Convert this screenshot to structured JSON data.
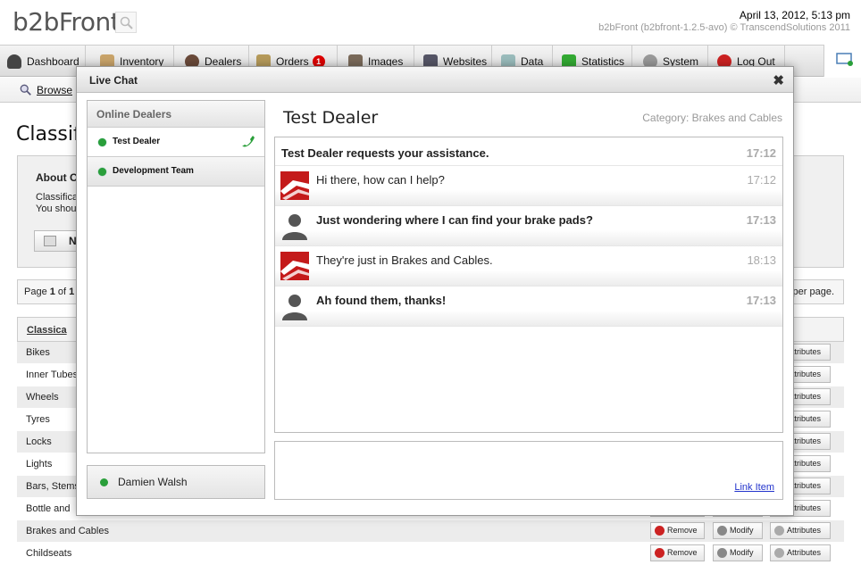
{
  "header": {
    "logo": "b2bFront",
    "datetime": "April 13, 2012, 5:13 pm",
    "version": "b2bFront (b2bfront-1.2.5-avo) © TranscendSolutions 2011"
  },
  "nav": {
    "items": [
      {
        "label": "Dashboard",
        "icon": "dashboard-icon"
      },
      {
        "label": "Inventory",
        "icon": "box-icon"
      },
      {
        "label": "Dealers",
        "icon": "person-icon"
      },
      {
        "label": "Orders",
        "icon": "orders-icon",
        "badge": "1"
      },
      {
        "label": "Images",
        "icon": "images-icon"
      },
      {
        "label": "Websites",
        "icon": "websites-icon"
      },
      {
        "label": "Data",
        "icon": "data-icon"
      },
      {
        "label": "Statistics",
        "icon": "chart-icon"
      },
      {
        "label": "System",
        "icon": "gear-icon"
      },
      {
        "label": "Log Out",
        "icon": "logout-icon"
      }
    ],
    "sub": {
      "browse": "Browse"
    }
  },
  "page": {
    "title": "Classific",
    "about_title": "About C",
    "about_text1": "Classifica",
    "about_text2": "You shou",
    "new_button": "N",
    "pager_left_prefix": "Page ",
    "pager_page": "1",
    "pager_of": " of ",
    "pager_total": "1",
    "pager_right": "per page.",
    "table_header": "Classica",
    "rows": [
      "Bikes",
      "Inner Tubes",
      "Wheels",
      "Tyres",
      "Locks",
      "Lights",
      "Bars, Stems",
      "Bottle and",
      "Brakes and Cables",
      "Childseats"
    ],
    "actions": {
      "remove": "Remove",
      "modify": "Modify",
      "attributes": "Attributes"
    }
  },
  "chat": {
    "title": "Live Chat",
    "close_glyph": "✖",
    "online_header": "Online Dealers",
    "dealers": [
      "Test Dealer",
      "Development Team"
    ],
    "me": "Damien Walsh",
    "conversation_title": "Test Dealer",
    "category": "Category: Brakes and Cables",
    "messages": [
      {
        "type": "sys",
        "text": "Test Dealer requests your assistance.",
        "time": "17:12"
      },
      {
        "type": "staff",
        "text": "Hi there, how can I help?",
        "time": "17:12"
      },
      {
        "type": "user",
        "text": "Just wondering where I can find your brake pads?",
        "time": "17:13"
      },
      {
        "type": "staff",
        "text": "They're just in Brakes and Cables.",
        "time": "18:13"
      },
      {
        "type": "user",
        "text": "Ah found them, thanks!",
        "time": "17:13"
      }
    ],
    "link_item": "Link Item",
    "colors": {
      "online": "#2a9f3a",
      "brand_red": "#c41a1a"
    }
  }
}
